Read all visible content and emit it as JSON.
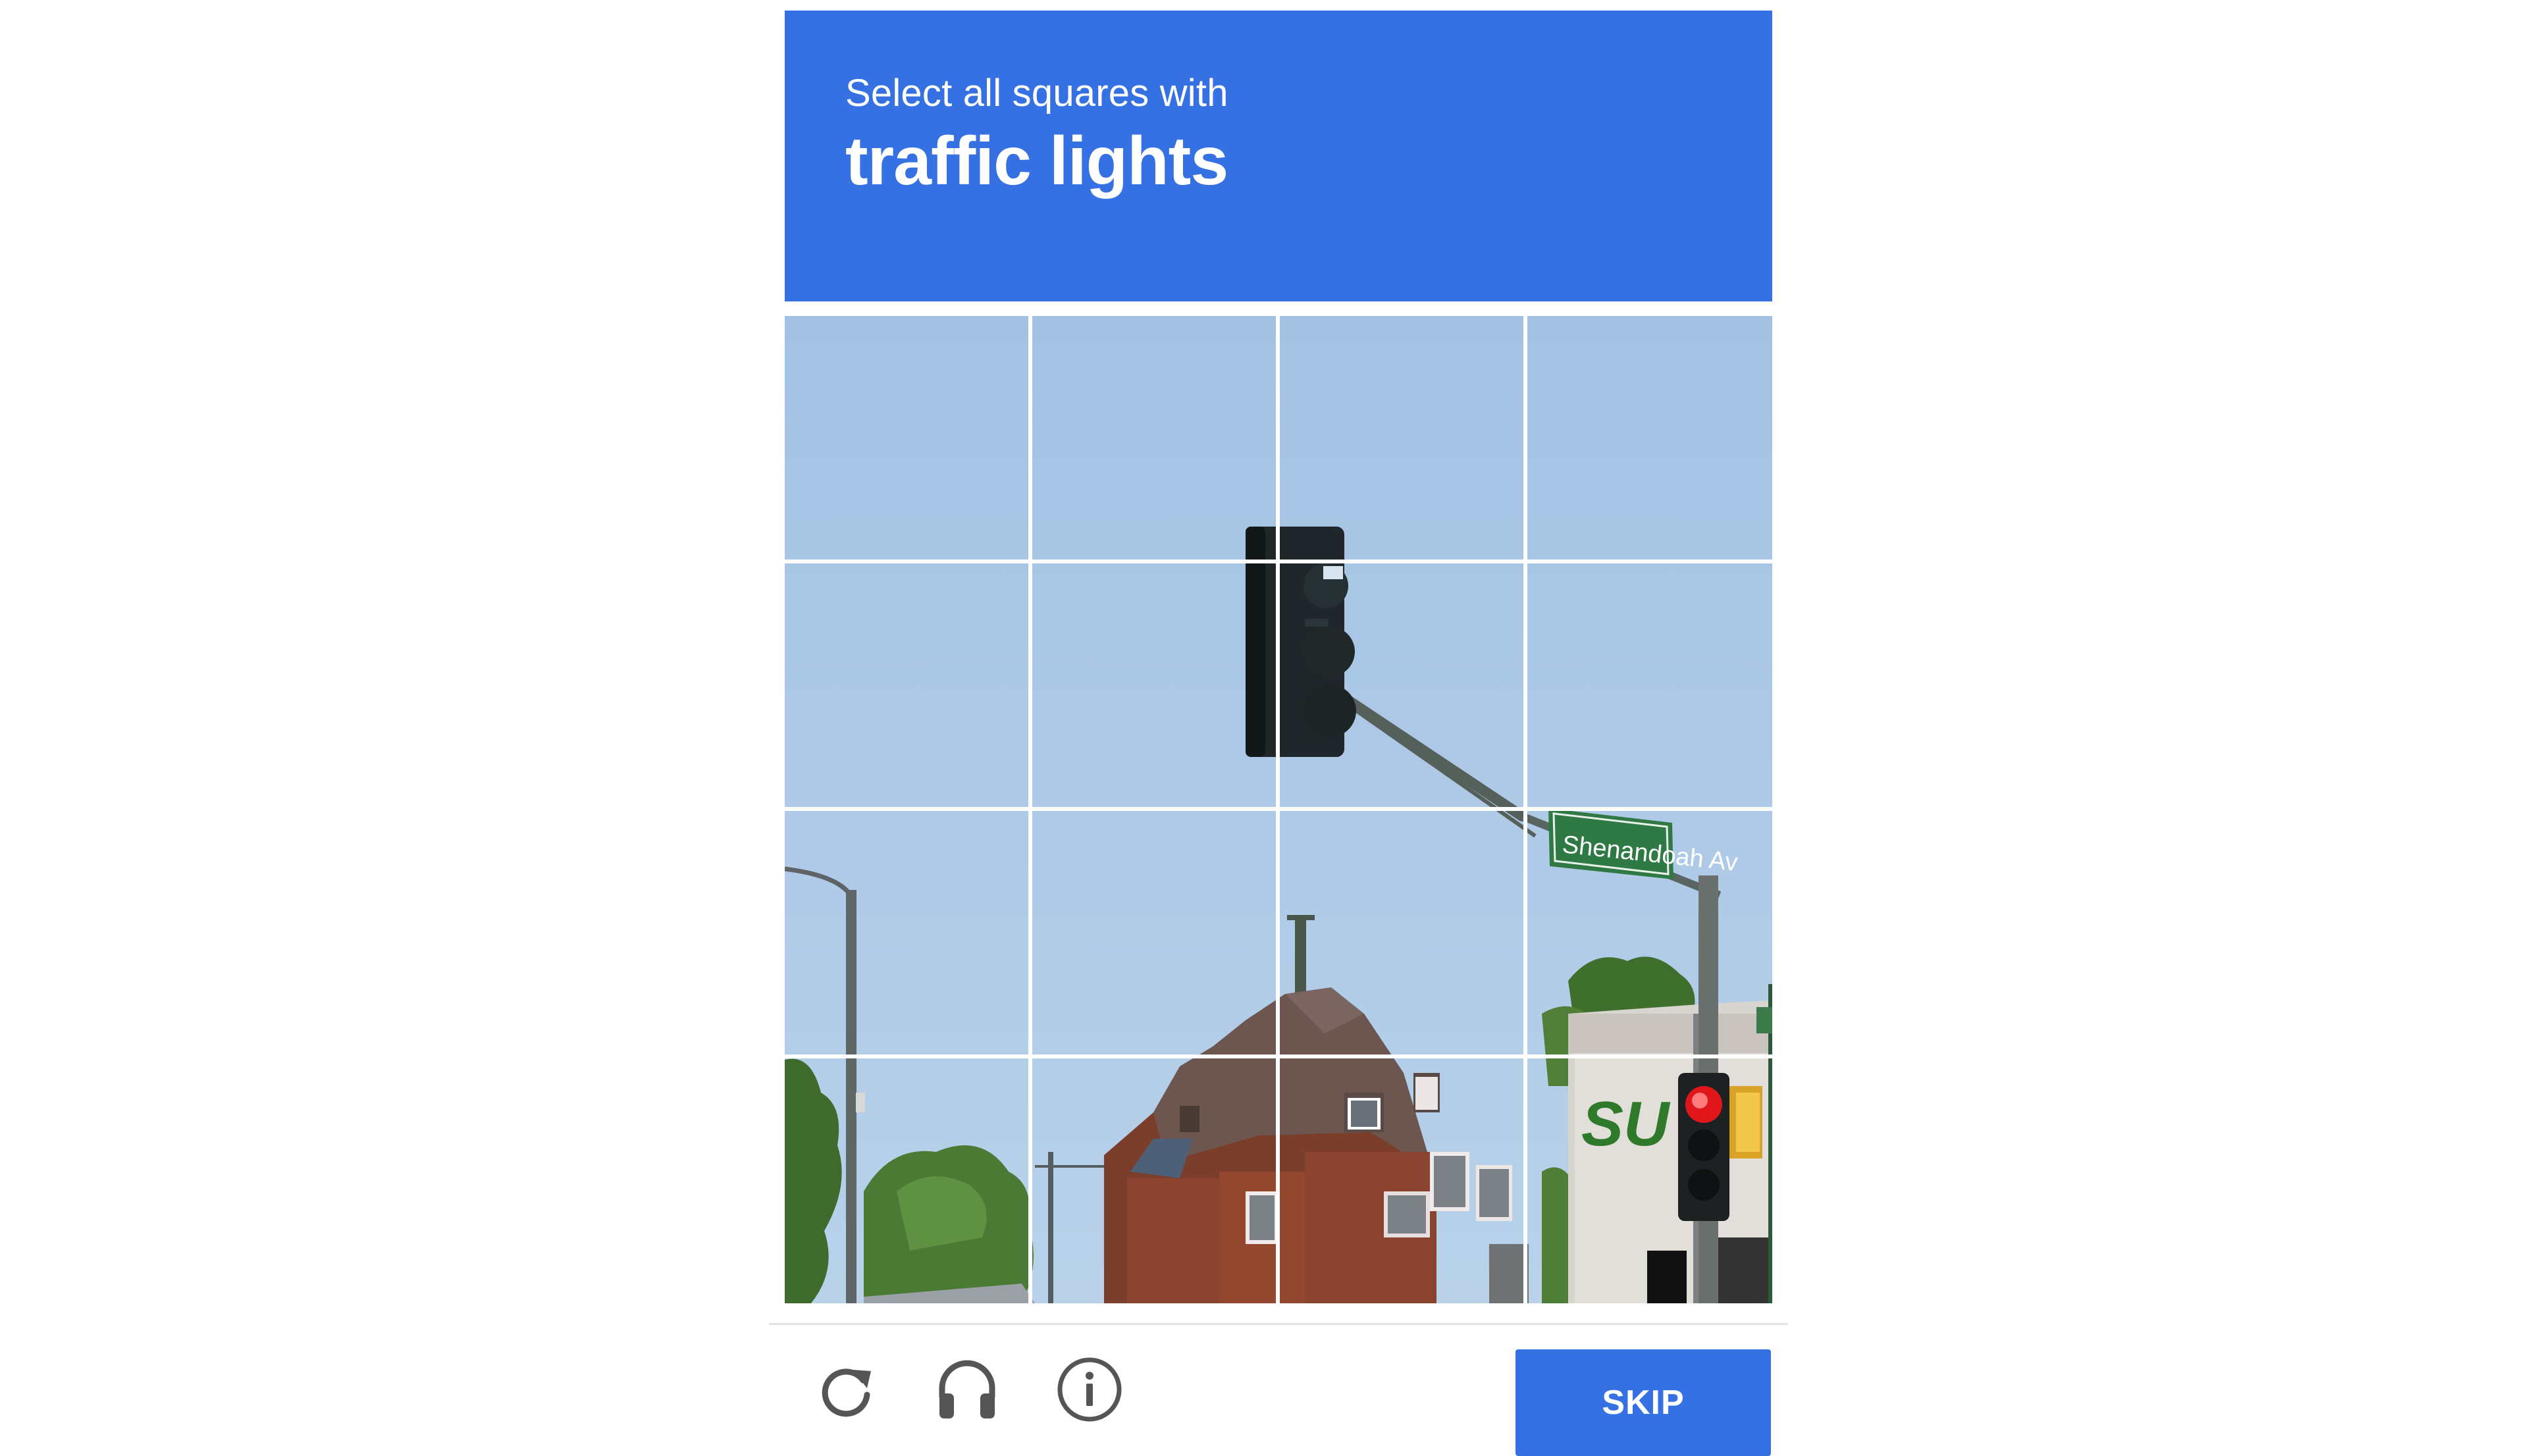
{
  "challenge": {
    "instruction_prefix": "Select all squares with",
    "target_object": "traffic lights"
  },
  "grid": {
    "rows": 4,
    "columns": 4,
    "tile_count": 16
  },
  "scene": {
    "sign_text": "Shenandoah Av",
    "store_sign_text": "SU"
  },
  "footer": {
    "reload_icon": "reload-icon",
    "audio_icon": "headphones-icon",
    "info_icon": "info-icon",
    "skip_label": "SKIP"
  },
  "colors": {
    "accent": "#3571e3",
    "grid_line": "#ffffff",
    "icon": "#555555"
  }
}
